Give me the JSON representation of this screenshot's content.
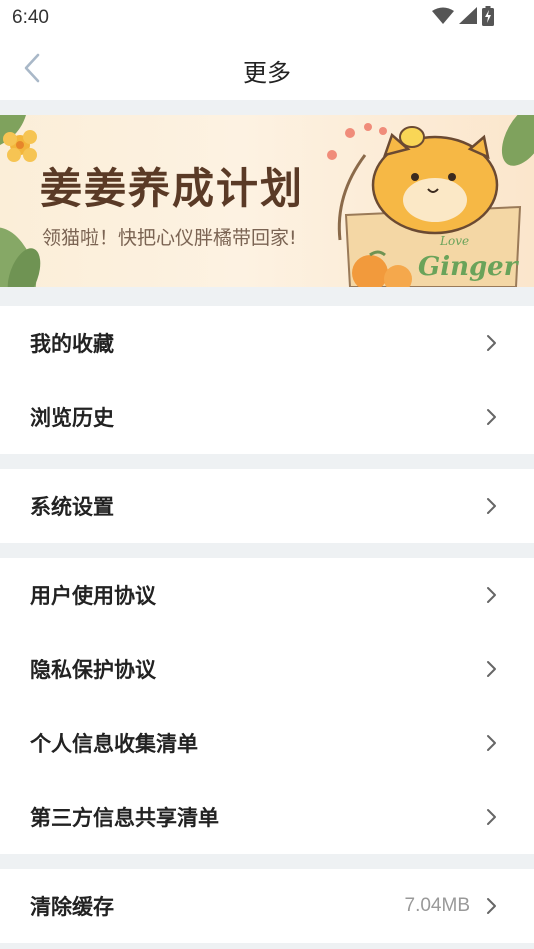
{
  "status_bar": {
    "time": "6:40",
    "icons": [
      "wifi-icon",
      "signal-icon",
      "battery-icon"
    ]
  },
  "nav": {
    "title": "更多",
    "back_icon": "chevron-left-icon"
  },
  "banner": {
    "title": "姜姜养成计划",
    "subtitle": "领猫啦！快把心仪胖橘带回家!",
    "box_text_main": "Ginger",
    "box_text_small": "Love"
  },
  "groups": [
    {
      "items": [
        {
          "label": "我的收藏"
        },
        {
          "label": "浏览历史"
        }
      ]
    },
    {
      "items": [
        {
          "label": "系统设置"
        }
      ]
    },
    {
      "items": [
        {
          "label": "用户使用协议"
        },
        {
          "label": "隐私保护协议"
        },
        {
          "label": "个人信息收集清单"
        },
        {
          "label": "第三方信息共享清单"
        }
      ]
    },
    {
      "items": [
        {
          "label": "清除缓存",
          "value": "7.04MB"
        }
      ]
    }
  ],
  "colors": {
    "background": "#eef1f3",
    "surface": "#ffffff",
    "banner_title": "#5a3a26",
    "chevron": "#666666",
    "back_icon": "#a9b8c8",
    "cache_value": "#999999"
  }
}
